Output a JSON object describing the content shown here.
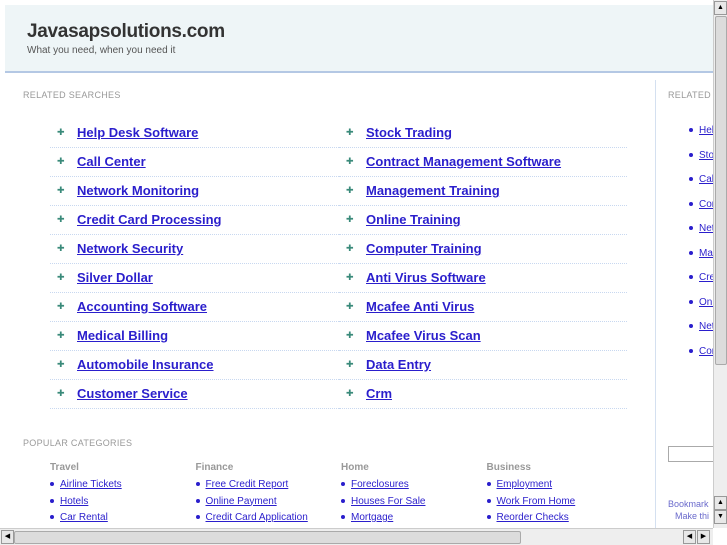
{
  "header": {
    "title": "Javasapsolutions.com",
    "tagline": "What you need, when you need it"
  },
  "related": {
    "label": "RELATED SEARCHES",
    "col1": [
      "Help Desk Software",
      "Call Center",
      "Network Monitoring",
      "Credit Card Processing",
      "Network Security",
      "Silver Dollar",
      "Accounting Software",
      "Medical Billing",
      "Automobile Insurance",
      "Customer Service"
    ],
    "col2": [
      "Stock Trading",
      "Contract Management Software",
      "Management Training",
      "Online Training",
      "Computer Training",
      "Anti Virus Software",
      "Mcafee Anti Virus",
      "Mcafee Virus Scan",
      "Data Entry",
      "Crm"
    ]
  },
  "sidebar": {
    "label": "RELATED",
    "items": [
      "Help Desk Software",
      "Stock Trading",
      "Call Center",
      "Contract Management Software",
      "Network Monitoring",
      "Management Training",
      "Credit Card Processing",
      "Online Training",
      "Network Security",
      "Computer Training"
    ],
    "bookmark": "Bookmark",
    "make": "Make thi"
  },
  "popular": {
    "label": "POPULAR CATEGORIES",
    "categories": [
      {
        "title": "Travel",
        "links": [
          "Airline Tickets",
          "Hotels",
          "Car Rental"
        ]
      },
      {
        "title": "Finance",
        "links": [
          "Free Credit Report",
          "Online Payment",
          "Credit Card Application"
        ]
      },
      {
        "title": "Home",
        "links": [
          "Foreclosures",
          "Houses For Sale",
          "Mortgage"
        ]
      },
      {
        "title": "Business",
        "links": [
          "Employment",
          "Work From Home",
          "Reorder Checks"
        ]
      }
    ]
  }
}
